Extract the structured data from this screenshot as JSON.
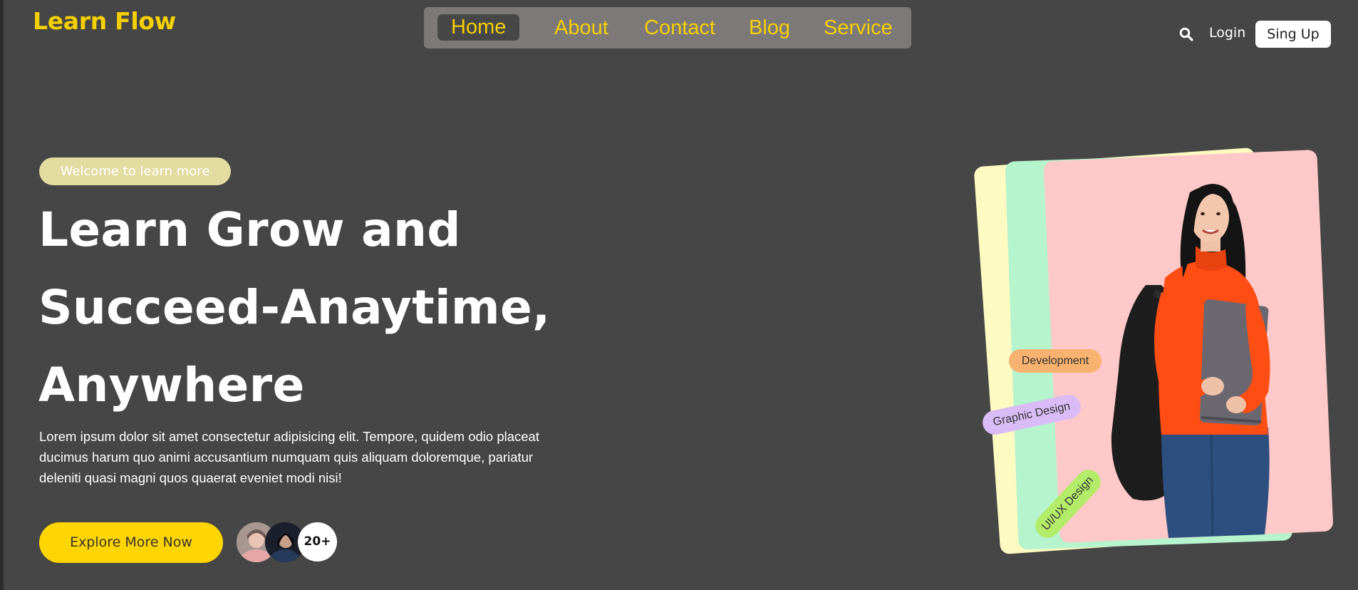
{
  "header": {
    "logo": "Learn Flow",
    "nav": [
      {
        "label": "Home"
      },
      {
        "label": "About"
      },
      {
        "label": "Contact"
      },
      {
        "label": "Blog"
      },
      {
        "label": "Service"
      }
    ],
    "login_label": "Login",
    "signup_label": "Sing Up"
  },
  "hero": {
    "badge": "Welcome to learn more",
    "title_line1": "Learn Grow and",
    "title_line2": "Succeed-Anaytime,",
    "title_line3": "Anywhere",
    "description": "Lorem ipsum dolor sit amet consectetur adipisicing elit. Tempore, quidem odio placeat ducimus harum quo animi accusantium numquam quis aliquam doloremque, pariatur deleniti quasi magni quos quaerat eveniet modi nisi!",
    "cta_label": "Explore More Now",
    "avatar_count": "20+"
  },
  "tags": {
    "development": "Development",
    "graphic": "Graphic Design",
    "uiux": "UI/UX Design"
  },
  "colors": {
    "background": "#464646",
    "accent": "#f5d000",
    "cta": "#ffd500",
    "card_yellow": "#fdfac2",
    "card_green": "#b6f4cd",
    "card_pink": "#ffc9c9"
  }
}
